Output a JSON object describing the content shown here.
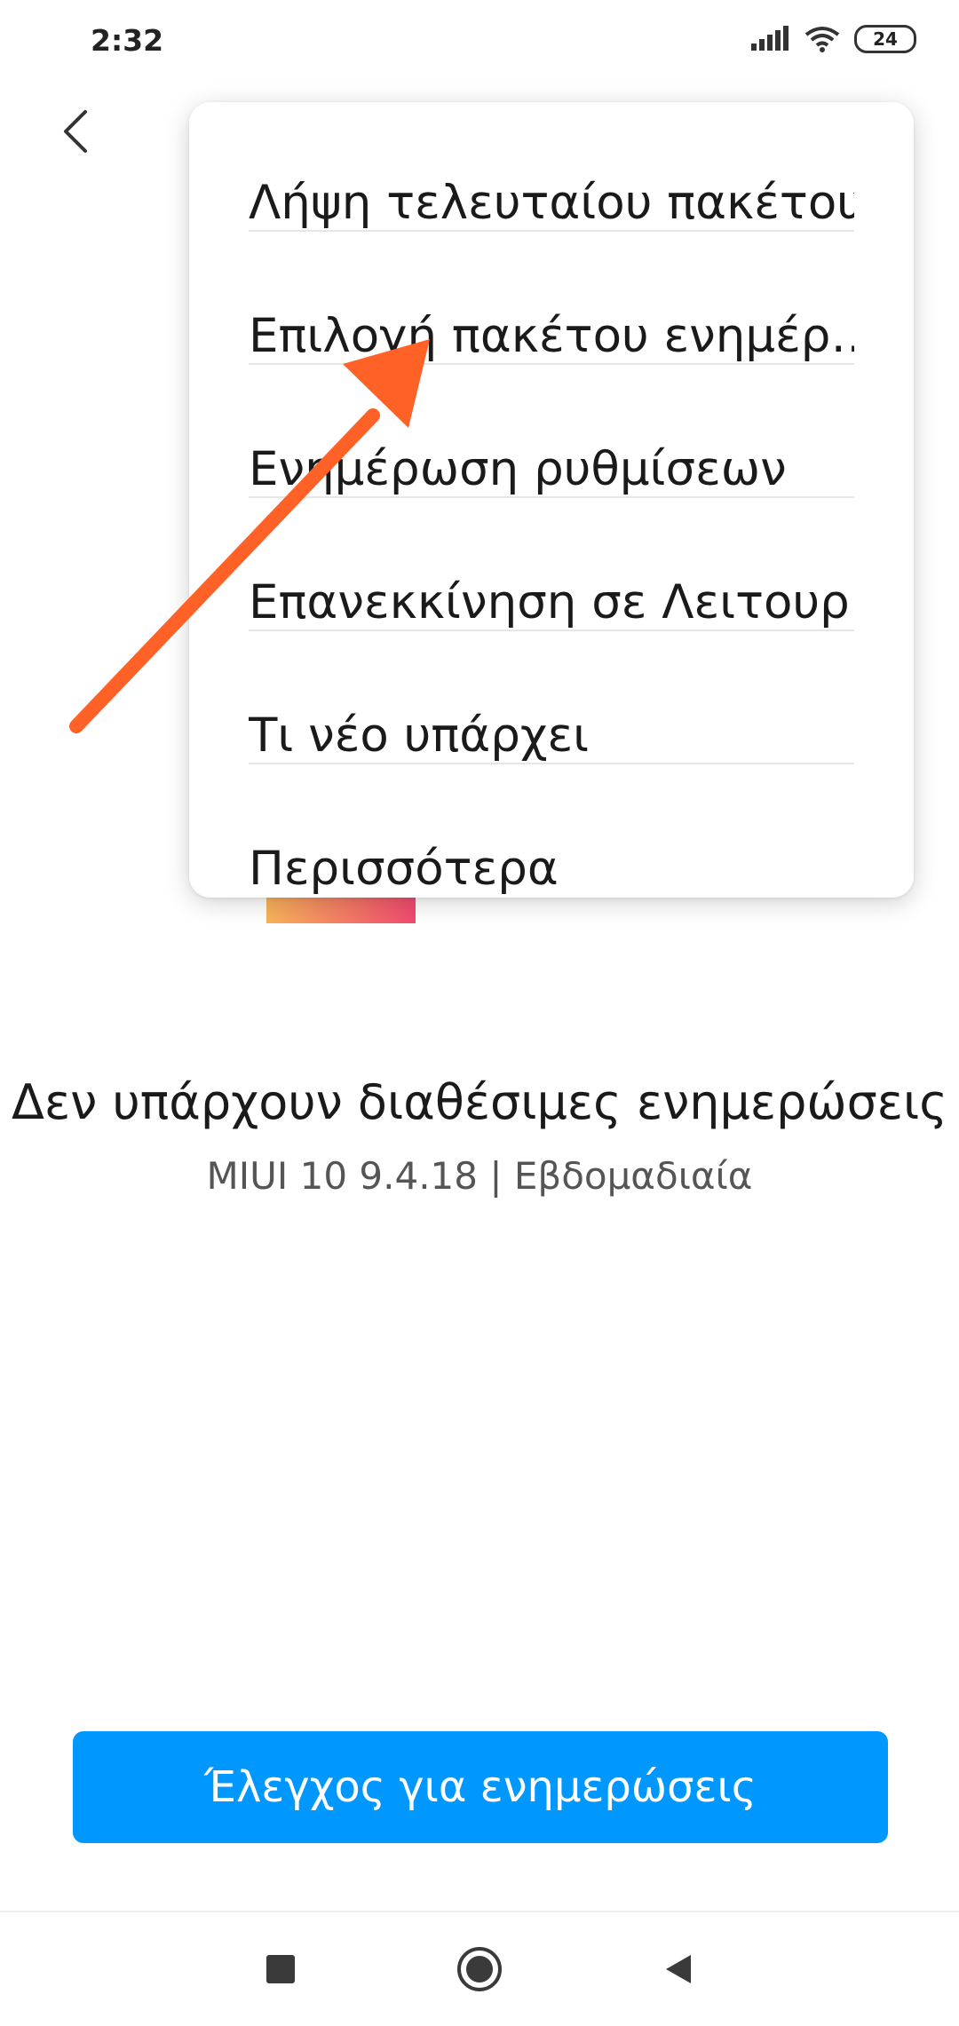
{
  "status_bar": {
    "time": "2:32",
    "battery_level": "24",
    "icons": [
      "signal-icon",
      "wifi-icon",
      "battery-icon"
    ]
  },
  "menu": {
    "items": [
      "Λήψη τελευταίου πακέτου",
      "Επιλογή πακέτου ενημέρ…",
      "Ενημέρωση ρυθμίσεων",
      "Επανεκκίνηση σε Λειτουρ…",
      "Τι νέο υπάρχει",
      "Περισσότερα"
    ]
  },
  "main": {
    "title": "Δεν υπάρχουν διαθέσιμες ενημερώσεις",
    "version": "MIUI 10 9.4.18 | Εβδομαδιαία"
  },
  "actions": {
    "check_label": "Έλεγχος για ενημερώσεις"
  },
  "colors": {
    "accent": "#0097ff",
    "annotation_arrow": "#ff6127"
  }
}
